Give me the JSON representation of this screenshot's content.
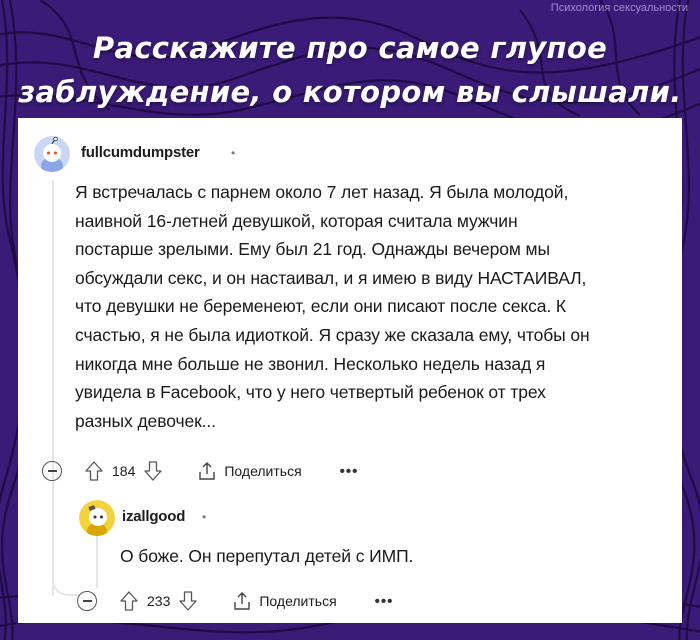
{
  "watermark": "Психология сексуальности",
  "headline": {
    "line1": "Расскажите про самое глупое",
    "line2": "заблуждение, о котором вы слышали."
  },
  "colors": {
    "background": "#3a1b78",
    "card": "#ffffff",
    "text": "#1a1a1b"
  },
  "comment": {
    "author": "fullcumdumpster",
    "separator": "•",
    "avatar_icon": "snoo-avatar-icon",
    "lines": [
      "Я встречалась с парнем около 7 лет назад. Я была молодой,",
      "наивной 16-летней девушкой, которая считала мужчин",
      "постарше зрелыми. Ему был 21 год. Однажды вечером мы",
      "обсуждали секс, и он настаивал, и я имею в виду НАСТАИВАЛ,",
      "что девушки не беременеют, если они писают после секса. К",
      "счастью, я не была идиоткой. Я сразу же сказала ему, чтобы он",
      "никогда мне больше не звонил. Несколько недель назад я",
      "увидела в Facebook, что у него четвертый ребенок от трех",
      "разных девочек..."
    ],
    "votes": "184",
    "share_label": "Поделиться",
    "more_label": "•••"
  },
  "reply": {
    "author": "izallgood",
    "separator": "•",
    "avatar_icon": "snoo-avatar-icon",
    "text": "О боже. Он перепутал детей с ИМП.",
    "votes": "233",
    "share_label": "Поделиться",
    "more_label": "•••"
  }
}
